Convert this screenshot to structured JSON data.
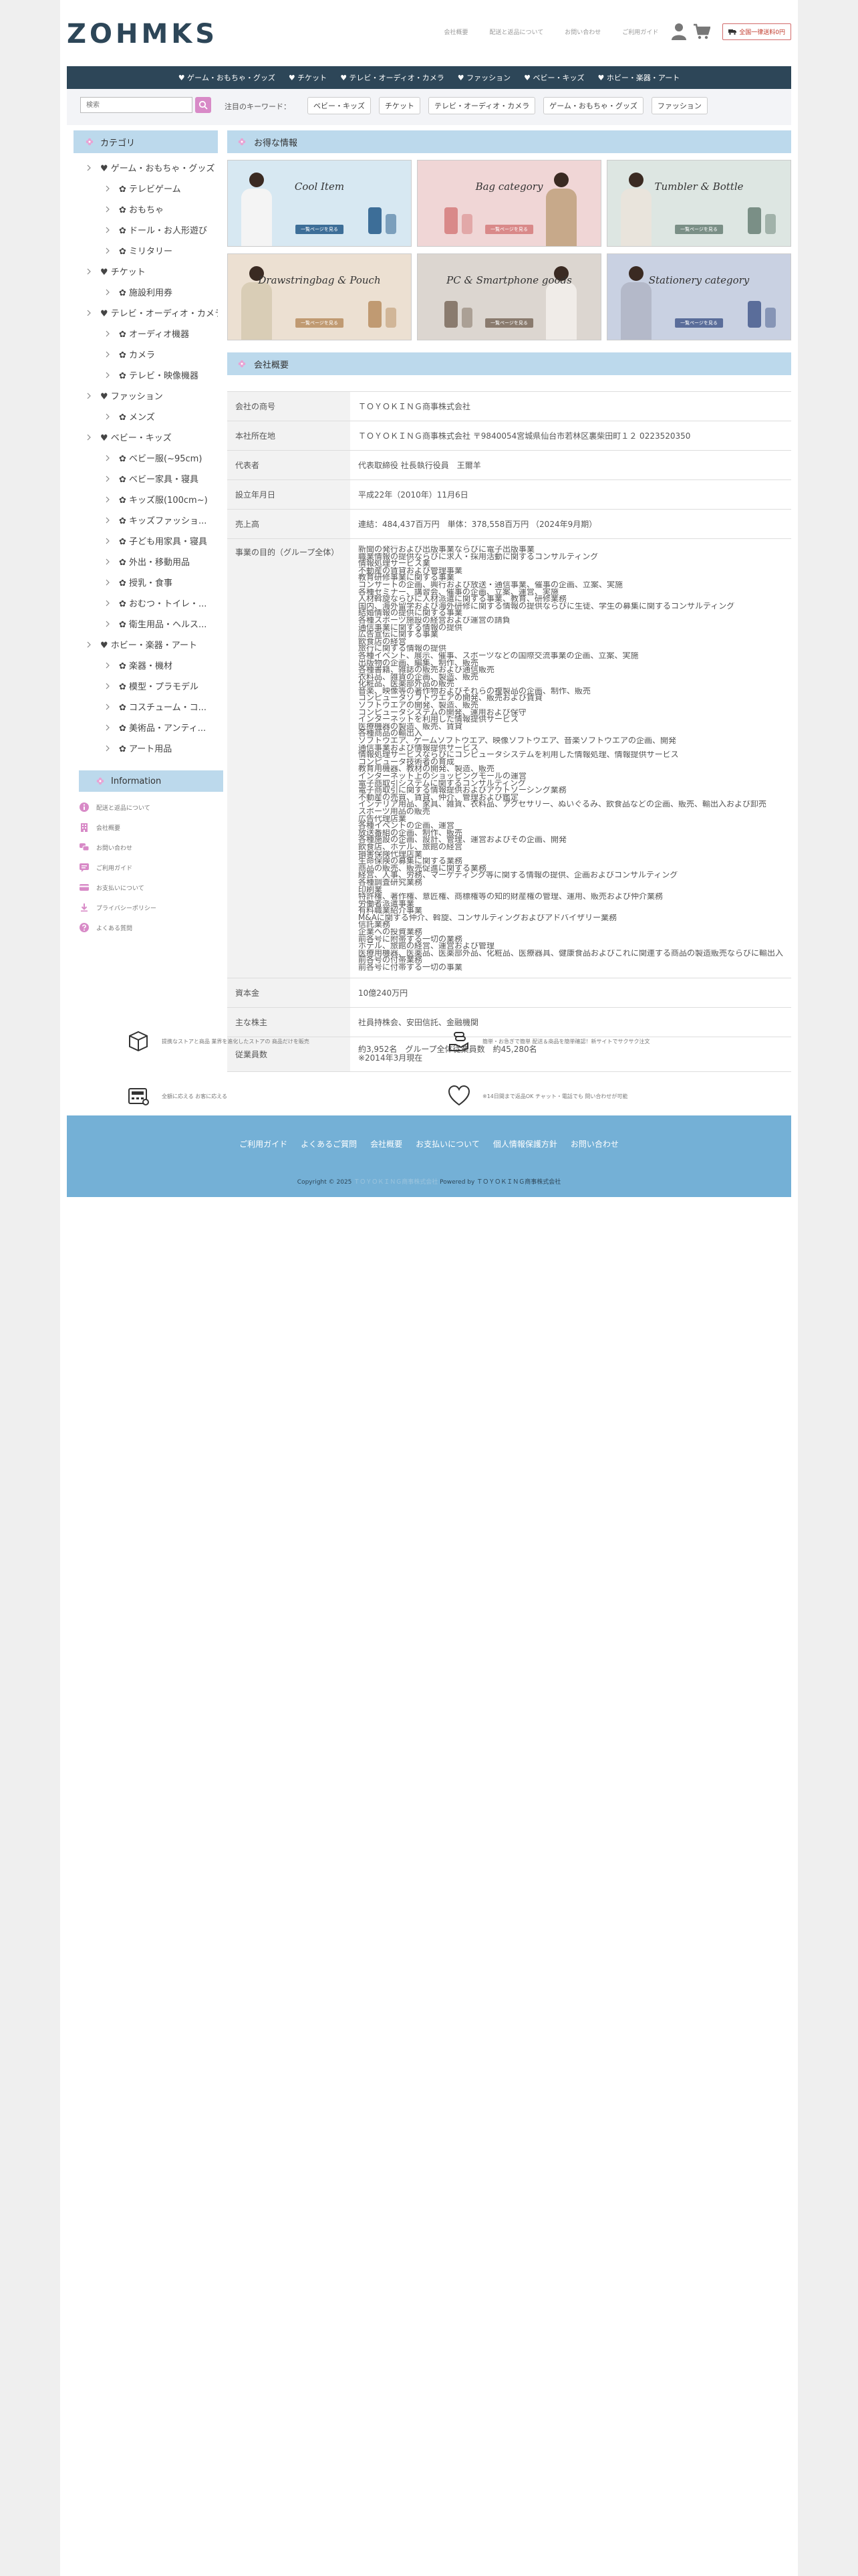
{
  "header": {
    "logo": "ZOHMKS",
    "links": [
      "会社概要",
      "配送と返品について",
      "お問い合わせ",
      "ご利用ガイド"
    ],
    "shipping": "全国一律送料0円"
  },
  "nav": {
    "items": [
      "♥ ゲーム・おもちゃ・グッズ",
      "♥ チケット",
      "♥ テレビ・オーディオ・カメラ",
      "♥ ファッション",
      "♥ ベビー・キッズ",
      "♥ ホビー・楽器・アート"
    ]
  },
  "search": {
    "placeholder": "検索",
    "keyword_label": "注目のキーワード：",
    "keywords": [
      "ベビー・キッズ",
      "チケット",
      "テレビ・オーディオ・カメラ",
      "ゲーム・おもちゃ・グッズ",
      "ファッション"
    ]
  },
  "sidebar": {
    "title": "カテゴリ",
    "categories": [
      {
        "label": "♥ ゲーム・おもちゃ・グッズ",
        "level": 1
      },
      {
        "label": "✿ テレビゲーム",
        "level": 2
      },
      {
        "label": "✿ おもちゃ",
        "level": 2
      },
      {
        "label": "✿ ドール・お人形遊び",
        "level": 2
      },
      {
        "label": "✿ ミリタリー",
        "level": 2
      },
      {
        "label": "♥ チケット",
        "level": 1
      },
      {
        "label": "✿ 施設利用券",
        "level": 2
      },
      {
        "label": "♥ テレビ・オーディオ・カメラ",
        "level": 1
      },
      {
        "label": "✿ オーディオ機器",
        "level": 2
      },
      {
        "label": "✿ カメラ",
        "level": 2
      },
      {
        "label": "✿ テレビ・映像機器",
        "level": 2
      },
      {
        "label": "♥ ファッション",
        "level": 1
      },
      {
        "label": "✿ メンズ",
        "level": 2
      },
      {
        "label": "♥ ベビー・キッズ",
        "level": 1
      },
      {
        "label": "✿ ベビー服(~95cm)",
        "level": 2
      },
      {
        "label": "✿ ベビー家具・寝具",
        "level": 2
      },
      {
        "label": "✿ キッズ服(100cm~)",
        "level": 2
      },
      {
        "label": "✿ キッズファッショ...",
        "level": 2
      },
      {
        "label": "✿ 子ども用家具・寝具",
        "level": 2
      },
      {
        "label": "✿ 外出・移動用品",
        "level": 2
      },
      {
        "label": "✿ 授乳・食事",
        "level": 2
      },
      {
        "label": "✿ おむつ・トイレ・...",
        "level": 2
      },
      {
        "label": "✿ 衛生用品・ヘルス...",
        "level": 2
      },
      {
        "label": "♥ ホビー・楽器・アート",
        "level": 1
      },
      {
        "label": "✿ 楽器・機材",
        "level": 2
      },
      {
        "label": "✿ 模型・プラモデル",
        "level": 2
      },
      {
        "label": "✿ コスチューム・コ...",
        "level": 2
      },
      {
        "label": "✿ 美術品・アンティ...",
        "level": 2
      },
      {
        "label": "✿ アート用品",
        "level": 2
      }
    ],
    "info_title": "Information",
    "info_items": [
      "配送と返品について",
      "会社概要",
      "お問い合わせ",
      "ご利用ガイド",
      "お支払いについて",
      "プライバシーポリシー",
      "よくある質問"
    ]
  },
  "main": {
    "deals_title": "お得な情報",
    "banners": [
      {
        "title": "Cool Item",
        "button": "一覧ページを見る",
        "bg": "#d7e8f2",
        "accent": "#3d6e98"
      },
      {
        "title": "Bag category",
        "button": "一覧ページを見る",
        "bg": "#f0d6d6",
        "accent": "#d98989"
      },
      {
        "title": "Tumbler & Bottle",
        "button": "一覧ページを見る",
        "bg": "#dde6e2",
        "accent": "#7a8f86"
      },
      {
        "title": "Drawstringbag & Pouch",
        "button": "一覧ページを見る",
        "bg": "#ece0d2",
        "accent": "#c09a72"
      },
      {
        "title": "PC & Smartphone goods",
        "button": "一覧ページを見る",
        "bg": "#dcd6d0",
        "accent": "#8a7b6e"
      },
      {
        "title": "Stationery category",
        "button": "一覧ページを見る",
        "bg": "#c9d1e2",
        "accent": "#5a6d9a"
      }
    ],
    "company_title": "会社概要",
    "company": {
      "rows": [
        {
          "key": "会社の商号",
          "value": "ＴＯＹＯＫＩＮＧ商事株式会社"
        },
        {
          "key": "本社所在地",
          "value": "ＴＯＹＯＫＩＮＧ商事株式会社 〒9840054宮城県仙台市若林区裏柴田町１２ 0223520350"
        },
        {
          "key": "代表者",
          "value": "代表取締役 社長執行役員　王爾羊"
        },
        {
          "key": "設立年月日",
          "value": "平成22年（2010年）11月6日"
        },
        {
          "key": "売上高",
          "value": "連結：484,437百万円　単体：378,558百万円 （2024年9月期）"
        }
      ],
      "purpose_key": "事業の目的（グループ全体）",
      "purpose_lines": [
        "新聞の発行および出版事業ならびに電子出版事業",
        "職業情報の提供ならびに求人・採用活動に関するコンサルティング",
        "情報処理サービス業",
        "不動産の賃貸および管理事業",
        "教育研修事業に関する事業",
        "コンサートの企画、興行および放送・通信事業、催事の企画、立案、実施",
        "各種セミナー、講習会、催事の企画、立案、運営、実施",
        "人材斡旋ならびに人材派遣に関する事業、教育、研修業務",
        "国内、海外留学および海外研修に関する情報の提供ならびに生徒、学生の募集に関するコンサルティング",
        "結婚情報の提供に関する事業",
        "各種スポーツ施設の経営および運営の請負",
        "通信事業に関する情報の提供",
        "広告宣伝に関する事業",
        "飲食店の経営",
        "旅行に関する情報の提供",
        "各種イベント、展示、催事、スポーツなどの国際交流事業の企画、立案、実施",
        "出版物の企画、編集、制作、販売",
        "各種書籍、雑誌の販売および通信販売",
        "衣料品、雑貨の企画、製造、販売",
        "化粧品、医薬部外品の販売",
        "音楽、映像等の著作物およびそれらの複製品の企画、制作、販売",
        "コンピュータソフトウエアの開発、販売および賃貸",
        "ソフトウエアの開発、製造、販売",
        "コンピュータシステムの開発、運用および保守",
        "インターネットを利用した情報提供サービス",
        "医療機器の製造、販売、賃貸",
        "各種商品の輸出入",
        "ソフトウエア、ゲームソフトウエア、映像ソフトウエア、音楽ソフトウエアの企画、開発",
        "通信事業および情報提供サービス",
        "情報処理サービスならびにコンピュータシステムを利用した情報処理、情報提供サービス",
        "コンピュータ技術者の育成",
        "教育用機器、教材の開発、製造、販売",
        "インターネット上のショッピングモールの運営",
        "電子商取引システムに関するコンサルティング",
        "電子商取引に関する情報提供およびアウトソーシング業務",
        "不動産の売買、賃貸、仲介、管理および鑑定",
        "インテリア用品、家具、雑貨、衣料品、アクセサリー、ぬいぐるみ、飲食品などの企画、販売、輸出入および卸売",
        "スポーツ用品の販売",
        "広告代理店業",
        "各種イベントの企画、運営",
        "放送番組の企画、制作、販売",
        "各種施設の企画、設計、管理、運営およびその企画、開発",
        "飲食店、ホテル、旅館の経営",
        "損害保険代理店業",
        "生命保険の募集に関する業務",
        "商品の販売、販売促進に関する業務",
        "経営、人事、労務、マーケティング等に関する情報の提供、企画およびコンサルティング",
        "各種調査研究業務",
        "印刷業",
        "特許権、著作権、意匠権、商標権等の知的財産権の管理、運用、販売および仲介業務",
        "労働者派遣事業",
        "有料職業紹介事業",
        "M&Aに関する仲介、斡旋、コンサルティングおよびアドバイザリー業務",
        "信託業務",
        "企業への投資業務",
        "前各号に附帯する一切の業務",
        "ホテル、旅館の経営、運営および管理",
        "医療用機器、医薬品、医薬部外品、化粧品、医療器具、健康食品およびこれに関連する商品の製造販売ならびに輸出入",
        "前各号の付帯業務",
        "前各号に付帯する一切の事業"
      ],
      "rows_after": [
        {
          "key": "資本金",
          "value": "10億240万円"
        },
        {
          "key": "主な株主",
          "value": "社員持株会、安田信託、金融機関"
        }
      ],
      "employees_key": "従業員数",
      "employees_lines": [
        "約3,952名　グループ全体従業員数　約45,280名",
        "※2014年3月現在"
      ]
    }
  },
  "features": [
    "提携なストアと商品 業界を進化したストアの 商品だけを販売",
    "簡単・お急ぎで簡単 配送＆商品を簡単確認！新サイトでサクサク注文",
    "全額に応える お客に応える",
    "※14日間まで返品OK チャット・電話でも 問い合わせが可能"
  ],
  "footer": {
    "links": [
      "ご利用ガイド",
      "よくあるご質問",
      "会社概要",
      "お支払いについて",
      "個人情報保護方針",
      "お問い合わせ"
    ],
    "copyright_prefix": "Copyright © 2025",
    "copyright_link": "ＴＯＹＯＫＩＮＧ商事株式会社",
    "copyright_suffix": "Powered by ＴＯＹＯＫＩＮＧ商事株式会社"
  },
  "colors": {
    "brand": "#2d4658",
    "accent_pink": "#d88ac7",
    "section_bg": "#bcd9ec",
    "footer_bg": "#74b0d6"
  }
}
